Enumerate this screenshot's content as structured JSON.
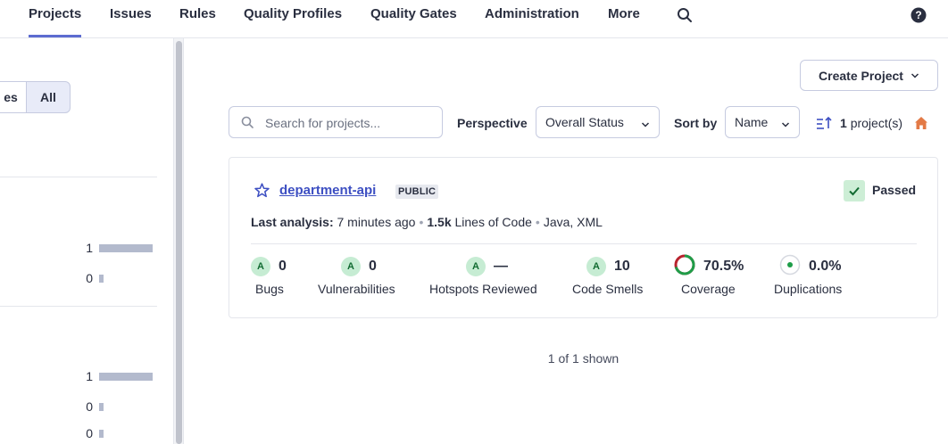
{
  "nav": {
    "items": [
      {
        "label": "Projects",
        "active": true
      },
      {
        "label": "Issues"
      },
      {
        "label": "Rules"
      },
      {
        "label": "Quality Profiles"
      },
      {
        "label": "Quality Gates"
      },
      {
        "label": "Administration"
      },
      {
        "label": "More"
      }
    ],
    "search_icon": "search-icon",
    "help_icon": "help-icon"
  },
  "sidebar": {
    "filter_toggle": {
      "left_label": "es",
      "all_label": "All",
      "selected": "All"
    },
    "facet_group_1": [
      {
        "count": "1",
        "fraction": 1.0
      },
      {
        "count": "0",
        "fraction": 0.0
      }
    ],
    "facet_group_2": [
      {
        "count": "1",
        "fraction": 1.0
      },
      {
        "count": "0",
        "fraction": 0.0
      },
      {
        "count": "0",
        "fraction": 0.0
      }
    ]
  },
  "toolbar": {
    "create_project_label": "Create Project",
    "search_placeholder": "Search for projects...",
    "perspective_label": "Perspective",
    "perspective_value": "Overall Status",
    "sort_by_label": "Sort by",
    "sort_value": "Name",
    "project_count": "1",
    "project_count_suffix": "project(s)",
    "sort_icon": "sort-ascending-icon",
    "home_icon": "home-icon"
  },
  "project": {
    "name": "department-api",
    "visibility": "PUBLIC",
    "quality_gate": "Passed",
    "last_analysis_label": "Last analysis:",
    "last_analysis_value": "7 minutes ago",
    "loc_value": "1.5k",
    "loc_label": "Lines of Code",
    "languages": "Java, XML",
    "metrics": [
      {
        "rating": "A",
        "value": "0",
        "label": "Bugs"
      },
      {
        "rating": "A",
        "value": "0",
        "label": "Vulnerabilities"
      },
      {
        "rating": "A",
        "value": "—",
        "label": "Hotspots Reviewed"
      },
      {
        "rating": "A",
        "value": "10",
        "label": "Code Smells"
      },
      {
        "value": "70.5%",
        "label": "Coverage",
        "fraction": 0.705
      },
      {
        "value": "0.0%",
        "label": "Duplications"
      }
    ],
    "colors": {
      "good": "#1e9d48",
      "bad": "#b8232e",
      "link": "#3d4fc2",
      "accent": "#5d6cd0"
    }
  },
  "footer": {
    "shown_text": "1 of 1 shown"
  }
}
